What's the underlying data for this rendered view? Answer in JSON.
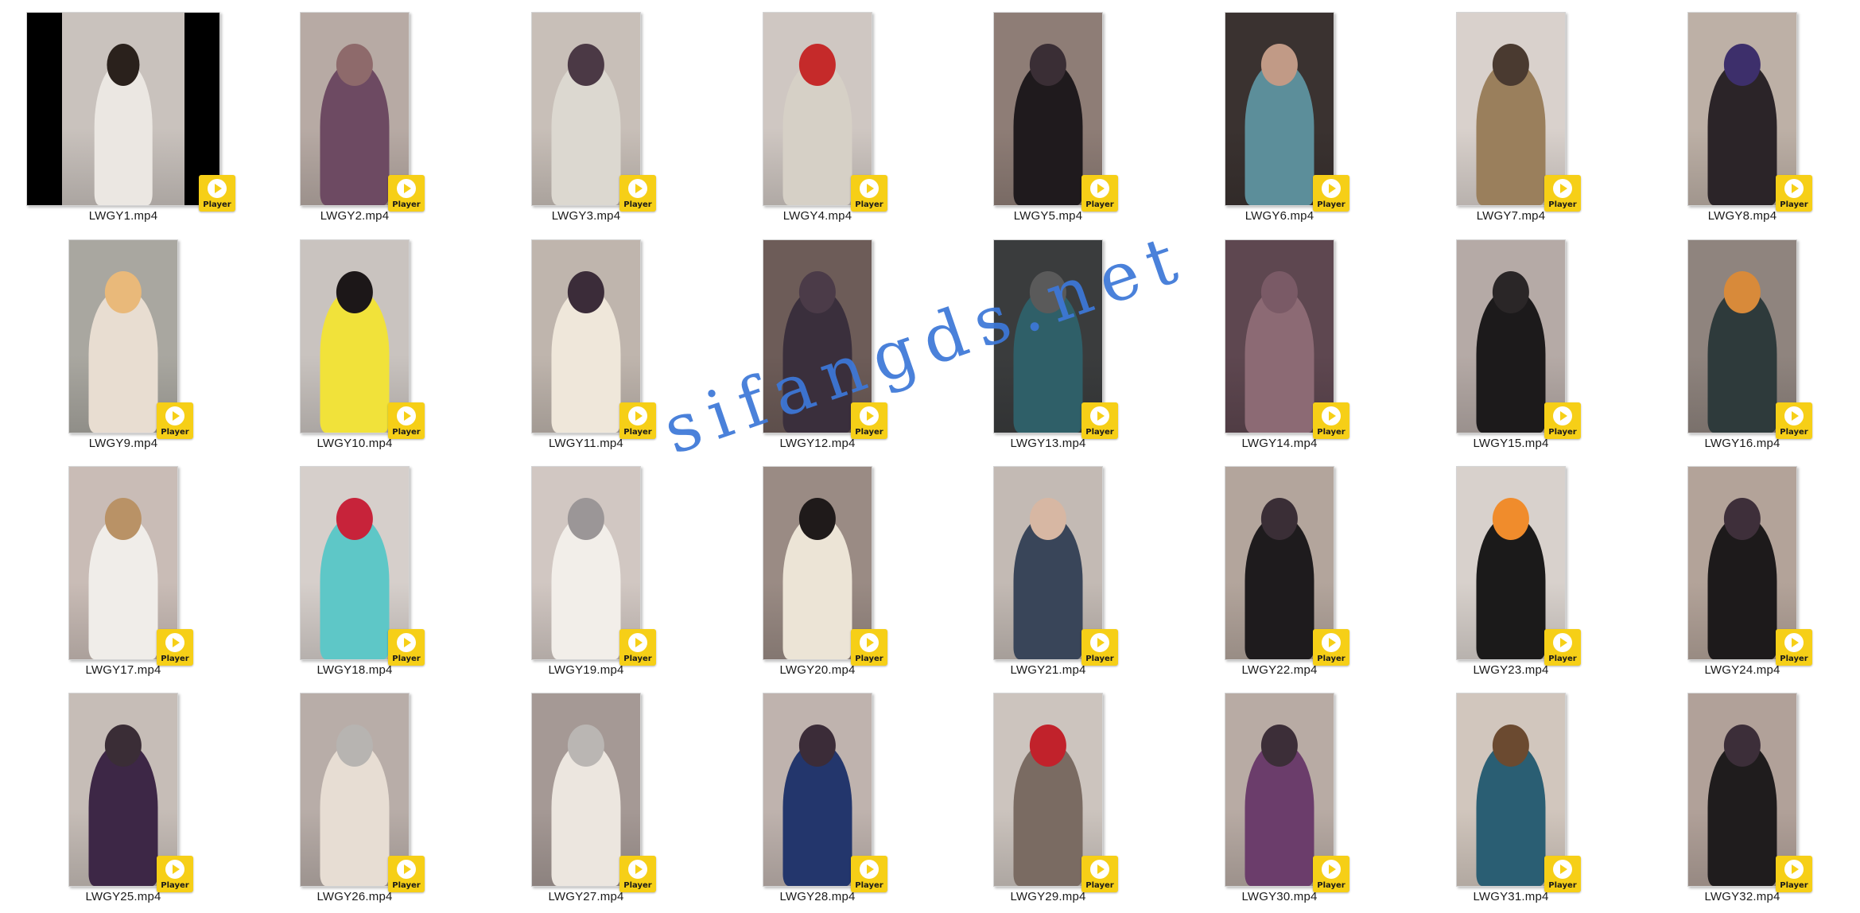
{
  "files": [
    {
      "name": "LWGY1.mp4",
      "badge": "Player",
      "bg": "#c9c2bd",
      "fig": "#ebe7e2",
      "head": "#2a211c",
      "wide": true
    },
    {
      "name": "LWGY2.mp4",
      "badge": "Player",
      "bg": "#b7aaa4",
      "fig": "#6d4a62",
      "head": "#8e6a6b"
    },
    {
      "name": "LWGY3.mp4",
      "badge": "Player",
      "bg": "#c8bfb8",
      "fig": "#dcd8d0",
      "head": "#4b3945"
    },
    {
      "name": "LWGY4.mp4",
      "badge": "Player",
      "bg": "#cfc7c2",
      "fig": "#d6d0c6",
      "head": "#c52a2a"
    },
    {
      "name": "LWGY5.mp4",
      "badge": "Player",
      "bg": "#8e7d76",
      "fig": "#1f1a1d",
      "head": "#3a2e35"
    },
    {
      "name": "LWGY6.mp4",
      "badge": "Player",
      "bg": "#3a3230",
      "fig": "#5c8e9a",
      "head": "#c19a86"
    },
    {
      "name": "LWGY7.mp4",
      "badge": "Player",
      "bg": "#d9d1cc",
      "fig": "#9a7f5c",
      "head": "#4a3a30"
    },
    {
      "name": "LWGY8.mp4",
      "badge": "Player",
      "bg": "#bdb0a6",
      "fig": "#2b2428",
      "head": "#3d2f6b"
    },
    {
      "name": "LWGY9.mp4",
      "badge": "Player",
      "bg": "#a9a7a0",
      "fig": "#e8ddd1",
      "head": "#e9b97a"
    },
    {
      "name": "LWGY10.mp4",
      "badge": "Player",
      "bg": "#c9c3bf",
      "fig": "#f1e23a",
      "head": "#1c1718"
    },
    {
      "name": "LWGY11.mp4",
      "badge": "Player",
      "bg": "#bfb5ad",
      "fig": "#efe7da",
      "head": "#3b2c39"
    },
    {
      "name": "LWGY12.mp4",
      "badge": "Player",
      "bg": "#6d5c58",
      "fig": "#3a2f3c",
      "head": "#4b3b48"
    },
    {
      "name": "LWGY13.mp4",
      "badge": "Player",
      "bg": "#3a3c3d",
      "fig": "#2f5f68",
      "head": "#5a5a5a"
    },
    {
      "name": "LWGY14.mp4",
      "badge": "Player",
      "bg": "#5e4750",
      "fig": "#8c6a74",
      "head": "#7a5a66"
    },
    {
      "name": "LWGY15.mp4",
      "badge": "Player",
      "bg": "#b5aaa6",
      "fig": "#1c1a1b",
      "head": "#2a2627"
    },
    {
      "name": "LWGY16.mp4",
      "badge": "Player",
      "bg": "#8f847e",
      "fig": "#2e3a3b",
      "head": "#d88a3a"
    },
    {
      "name": "LWGY17.mp4",
      "badge": "Player",
      "bg": "#c9bcb6",
      "fig": "#f0ede9",
      "head": "#b99266"
    },
    {
      "name": "LWGY18.mp4",
      "badge": "Player",
      "bg": "#d6cfcb",
      "fig": "#5ec7c7",
      "head": "#c7233a"
    },
    {
      "name": "LWGY19.mp4",
      "badge": "Player",
      "bg": "#d1c7c2",
      "fig": "#f2eee9",
      "head": "#9b9697"
    },
    {
      "name": "LWGY20.mp4",
      "badge": "Player",
      "bg": "#9a8b84",
      "fig": "#ece4d6",
      "head": "#1f1a1a"
    },
    {
      "name": "LWGY21.mp4",
      "badge": "Player",
      "bg": "#c3bab4",
      "fig": "#394559",
      "head": "#d7b7a3"
    },
    {
      "name": "LWGY22.mp4",
      "badge": "Player",
      "bg": "#b3a59c",
      "fig": "#1e1b1d",
      "head": "#3a2e36"
    },
    {
      "name": "LWGY23.mp4",
      "badge": "Player",
      "bg": "#d8d1cc",
      "fig": "#1b1a1a",
      "head": "#f08c2c"
    },
    {
      "name": "LWGY24.mp4",
      "badge": "Player",
      "bg": "#b3a399",
      "fig": "#1d1a1b",
      "head": "#3e2f3a"
    },
    {
      "name": "LWGY25.mp4",
      "badge": "Player",
      "bg": "#c6bdb7",
      "fig": "#3d2746",
      "head": "#3a2d36"
    },
    {
      "name": "LWGY26.mp4",
      "badge": "Player",
      "bg": "#b8ada8",
      "fig": "#e7ddd3",
      "head": "#b7b4b1"
    },
    {
      "name": "LWGY27.mp4",
      "badge": "Player",
      "bg": "#a59995",
      "fig": "#ece6df",
      "head": "#bab6b3"
    },
    {
      "name": "LWGY28.mp4",
      "badge": "Player",
      "bg": "#bfb3ae",
      "fig": "#23366c",
      "head": "#3b2c38"
    },
    {
      "name": "LWGY29.mp4",
      "badge": "Player",
      "bg": "#ccc4be",
      "fig": "#7a6b62",
      "head": "#c1222b"
    },
    {
      "name": "LWGY30.mp4",
      "badge": "Player",
      "bg": "#b8aba4",
      "fig": "#6b3d6b",
      "head": "#3c2e38"
    },
    {
      "name": "LWGY31.mp4",
      "badge": "Player",
      "bg": "#d1c6bd",
      "fig": "#2a5e73",
      "head": "#6b4a30"
    },
    {
      "name": "LWGY32.mp4",
      "badge": "Player",
      "bg": "#b1a199",
      "fig": "#1f1c1d",
      "head": "#3c2e39"
    }
  ],
  "watermark": "sifangds.net"
}
